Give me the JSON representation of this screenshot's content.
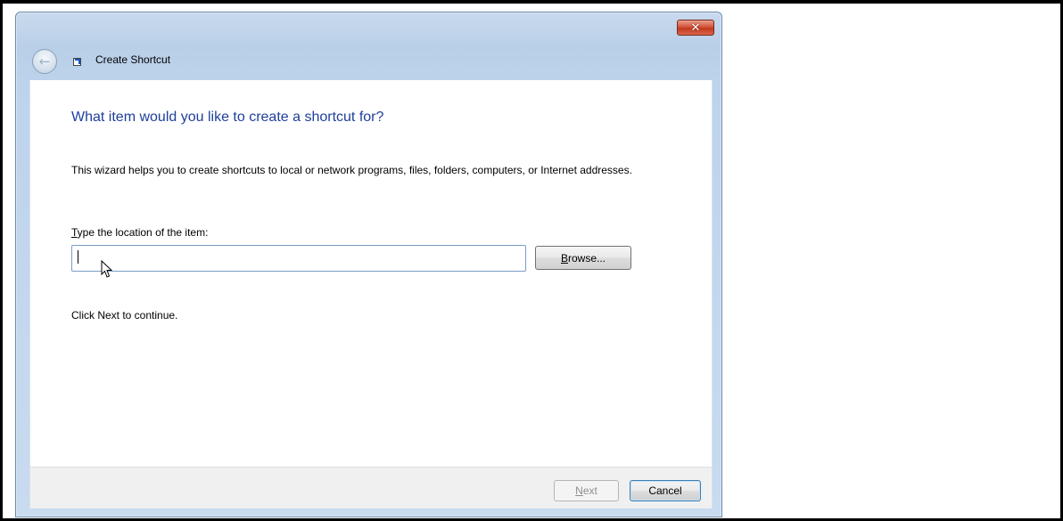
{
  "window": {
    "title": "Create Shortcut",
    "close_glyph": "✕"
  },
  "nav": {
    "back_glyph": "←"
  },
  "main": {
    "heading": "What item would you like to create a shortcut for?",
    "description": "This wizard helps you to create shortcuts to local or network programs, files, folders, computers, or Internet addresses.",
    "location_label_access": "T",
    "location_label_rest": "ype the location of the item:",
    "location_value": "",
    "browse_access": "B",
    "browse_rest": "rowse...",
    "hint": "Click Next to continue."
  },
  "footer": {
    "next_access": "N",
    "next_rest": "ext",
    "cancel_label": "Cancel",
    "next_enabled": false
  },
  "icons": {
    "back": "back-arrow-icon",
    "close": "close-icon",
    "shortcut": "shortcut-icon",
    "cursor": "mouse-pointer-icon"
  },
  "colors": {
    "heading": "#1e3f9c",
    "title_bar": "#b9cfe8",
    "close_button": "#c23a20",
    "footer_bg": "#f0f0f0"
  }
}
